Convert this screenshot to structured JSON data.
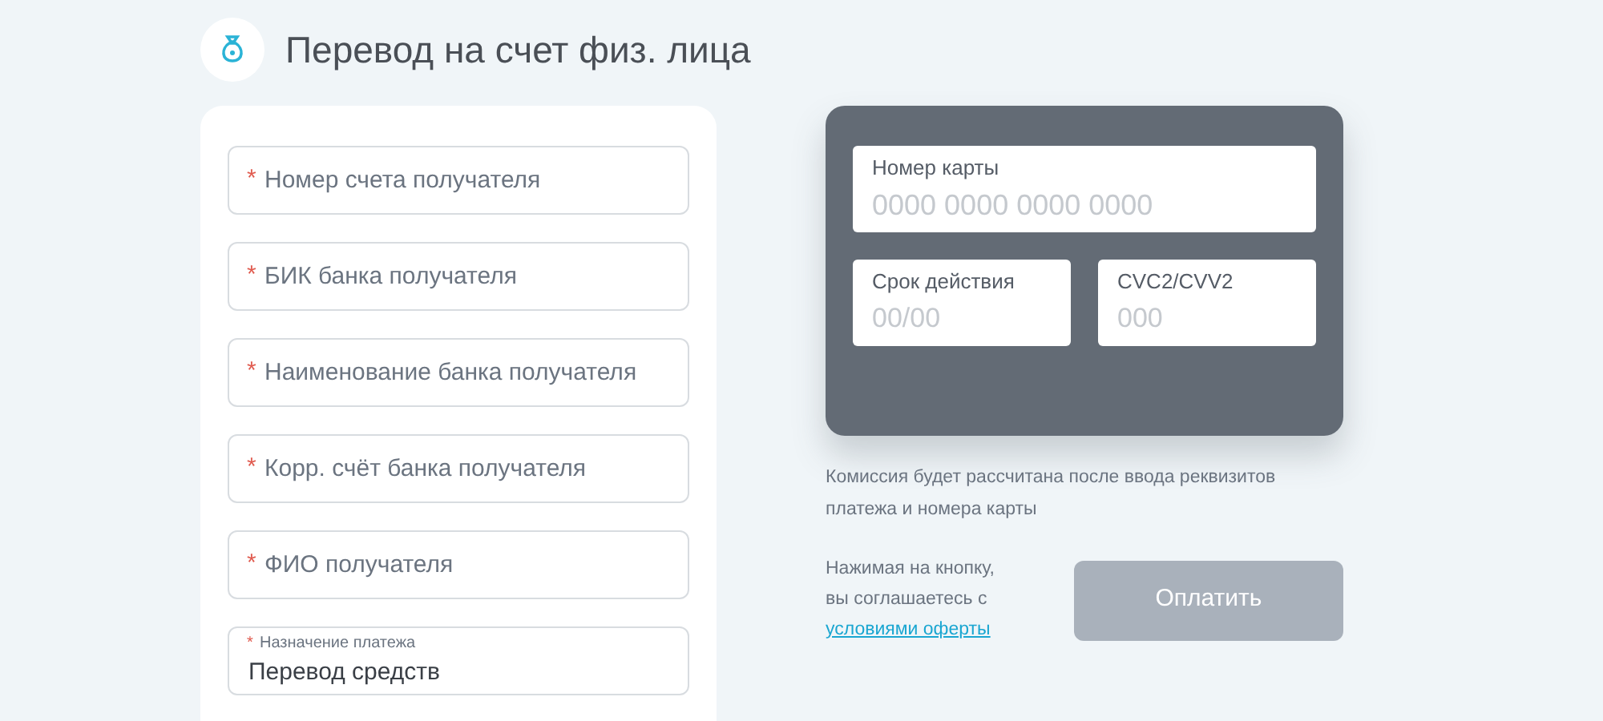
{
  "title": "Перевод на счет физ. лица",
  "form_fields": [
    {
      "kind": "placeholder",
      "required_mark": "*",
      "placeholder": "Номер счета получателя"
    },
    {
      "kind": "placeholder",
      "required_mark": "*",
      "placeholder": "БИК банка получателя"
    },
    {
      "kind": "placeholder",
      "required_mark": "*",
      "placeholder": "Наименование банка получателя"
    },
    {
      "kind": "placeholder",
      "required_mark": "*",
      "placeholder": "Корр. счёт банка получателя"
    },
    {
      "kind": "placeholder",
      "required_mark": "*",
      "placeholder": "ФИО получателя"
    },
    {
      "kind": "filled",
      "required_mark": "*",
      "label": "Назначение платежа",
      "value": "Перевод средств"
    }
  ],
  "card": {
    "number": {
      "label": "Номер карты",
      "placeholder": "0000 0000 0000 0000"
    },
    "expiry": {
      "label": "Срок действия",
      "placeholder": "00/00"
    },
    "cvc": {
      "label": "CVC2/CVV2",
      "placeholder": "000"
    }
  },
  "commission_note": "Комиссия будет рассчитана после ввода реквизитов платежа и номера карты",
  "agreement": {
    "text_lines": [
      "Нажимая на кнопку,",
      "вы соглашаетесь с"
    ],
    "link": "условиями оферты"
  },
  "pay_button": {
    "label": "Оплатить",
    "disabled": true
  }
}
